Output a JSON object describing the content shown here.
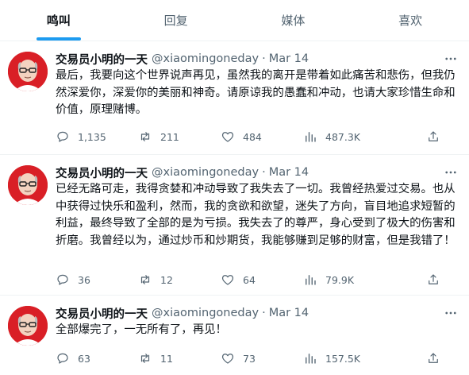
{
  "tabs": [
    {
      "label": "鸣叫",
      "active": true
    },
    {
      "label": "回复",
      "active": false
    },
    {
      "label": "媒体",
      "active": false
    },
    {
      "label": "喜欢",
      "active": false
    }
  ],
  "tweets": [
    {
      "name": "交易员小明的一天",
      "handle": "@xiaomingoneday",
      "dot": "·",
      "date": "Mar 14",
      "text": "最后，我要向这个世界说声再见，虽然我的离开是带着如此痛苦和悲伤，但我仍然深爱你，深爱你的美丽和神奇。请原谅我的愚蠢和冲动，也请大家珍惜生命和价值，原理赌博。",
      "replies": "1,135",
      "retweets": "211",
      "likes": "484",
      "views": "487.3K"
    },
    {
      "name": "交易员小明的一天",
      "handle": "@xiaomingoneday",
      "dot": "·",
      "date": "Mar 14",
      "text": "已经无路可走，我得贪婪和冲动导致了我失去了一切。我曾经热爱过交易。也从中获得过快乐和盈利，然而，我的贪欲和欲望，迷失了方向，盲目地追求短暂的利益，最终导致了全部的是为亏损。我失去了的尊严，身心受到了极大的伤害和折磨。我曾经以为，通过炒币和炒期货，我能够赚到足够的财富，但是我错了！",
      "replies": "36",
      "retweets": "12",
      "likes": "64",
      "views": "79.9K"
    },
    {
      "name": "交易员小明的一天",
      "handle": "@xiaomingoneday",
      "dot": "·",
      "date": "Mar 14",
      "text": "全部爆完了，一无所有了，再见！",
      "replies": "63",
      "retweets": "11",
      "likes": "73",
      "views": "157.5K"
    }
  ],
  "colors": {
    "accent": "#1d9bf0",
    "avatar_bg": "#d91f26",
    "text_secondary": "#536471"
  }
}
